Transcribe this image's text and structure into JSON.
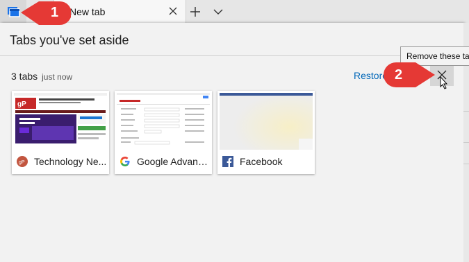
{
  "browser": {
    "active_tab_label": "New tab"
  },
  "panel": {
    "title": "Tabs you've set aside",
    "group_count": "3 tabs",
    "group_time": "just now",
    "restore_label": "Restore",
    "remove_tooltip": "Remove these tabs"
  },
  "cards": [
    {
      "title": "Technology Ne...",
      "favicon": "gp-icon"
    },
    {
      "title": "Google Advanc...",
      "favicon": "google-icon"
    },
    {
      "title": "Facebook",
      "favicon": "facebook-icon"
    }
  ],
  "callouts": [
    {
      "number": "1"
    },
    {
      "number": "2"
    }
  ],
  "colors": {
    "accent_link": "#0067b8",
    "callout_red": "#e53935",
    "tab_icon_blue": "#1a73e8"
  }
}
